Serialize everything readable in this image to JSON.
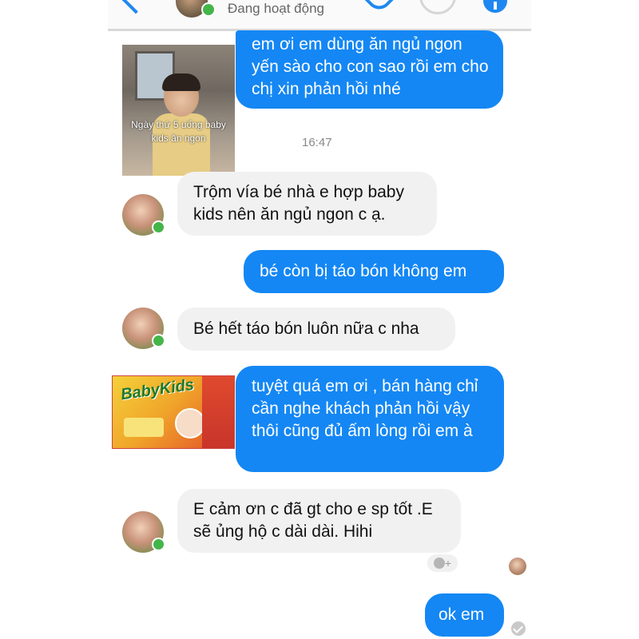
{
  "header": {
    "status": "Đang hoạt động"
  },
  "messages": [
    {
      "side": "out",
      "text": "em ơi em dùng ăn ngủ ngon yến sào cho con sao rồi em cho chị xin phản hồi nhé"
    },
    {
      "side": "in",
      "text": "Trộm vía bé nhà e hợp baby kids nên ăn ngủ ngon c ạ."
    },
    {
      "side": "out",
      "text": "bé còn bị táo bón không em"
    },
    {
      "side": "in",
      "text": "Bé hết táo bón luôn nữa c nha"
    },
    {
      "side": "out",
      "text": "tuyệt quá em ơi , bán hàng chỉ cần nghe khách phản hồi vậy thôi cũng đủ ấm lòng rồi em à"
    },
    {
      "side": "in",
      "text": "E cảm ơn c đã gt cho e sp tốt .E sẽ ủng hộ c dài dài. Hihi"
    },
    {
      "side": "out",
      "text": "ok em"
    }
  ],
  "timestamp": "16:47",
  "photo_caption": "Ngày thứ 5 uống baby kids ăn ngon",
  "product_brand": "BabyKids",
  "reaction_plus": "+",
  "icons": {
    "back": "back-arrow-icon",
    "call": "phone-icon",
    "video": "video-call-icon",
    "info": "info-icon",
    "reaction": "add-reaction-icon",
    "delivered": "check-circle-icon"
  },
  "colors": {
    "outgoing_bubble": "#1487f4",
    "incoming_bubble": "#f1f1f1",
    "accent": "#1e88f0",
    "online": "#44b549"
  }
}
